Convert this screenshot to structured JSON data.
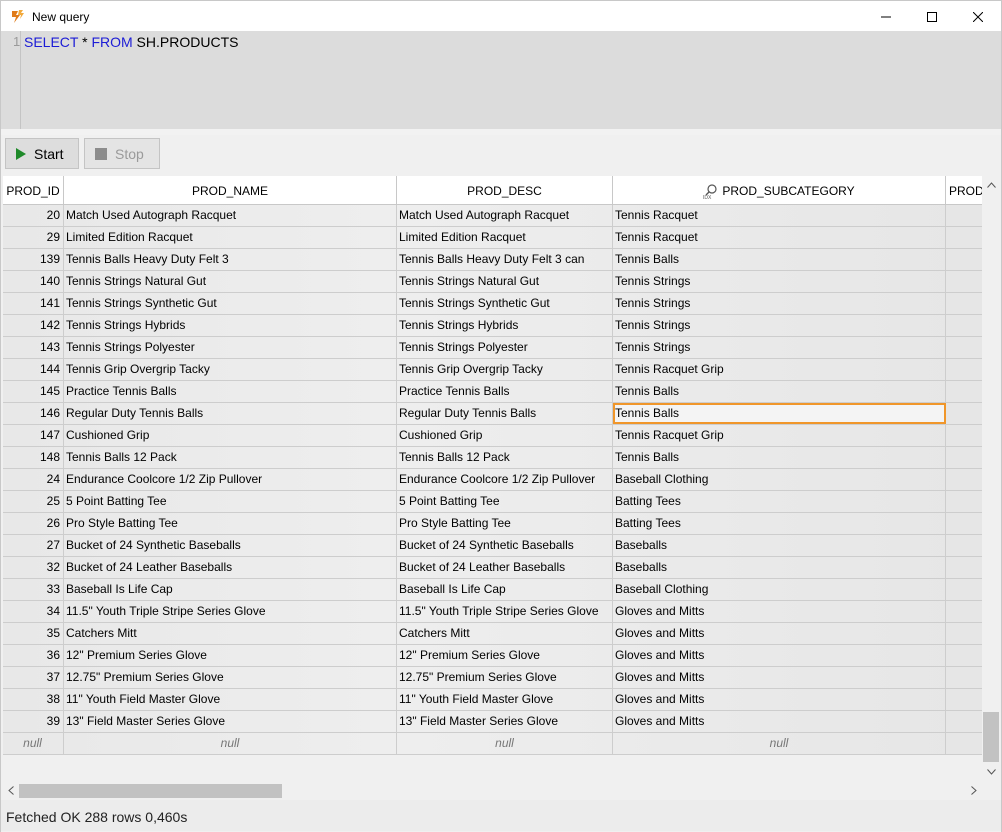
{
  "window": {
    "title": "New query",
    "minimize_icon": "minimize-icon",
    "maximize_icon": "maximize-icon",
    "close_icon": "close-icon"
  },
  "editor": {
    "line_number": "1",
    "keyword_select": "SELECT",
    "star": " * ",
    "keyword_from": "FROM",
    "table": " SH.PRODUCTS"
  },
  "toolbar": {
    "start_label": "Start",
    "stop_label": "Stop"
  },
  "grid": {
    "columns": [
      "PROD_ID",
      "PROD_NAME",
      "PROD_DESC",
      "PROD_SUBCATEGORY",
      "PROD"
    ],
    "index_icon": "index-search-icon",
    "rows": [
      [
        "20",
        "Match Used Autograph Racquet",
        "Match Used Autograph Racquet",
        "Tennis Racquet"
      ],
      [
        "29",
        "Limited Edition Racquet",
        "Limited Edition Racquet",
        "Tennis Racquet"
      ],
      [
        "139",
        "Tennis Balls Heavy Duty Felt 3",
        "Tennis Balls Heavy Duty Felt 3 can",
        "Tennis Balls"
      ],
      [
        "140",
        "Tennis Strings Natural Gut",
        "Tennis Strings Natural Gut",
        "Tennis Strings"
      ],
      [
        "141",
        "Tennis Strings Synthetic Gut",
        "Tennis Strings Synthetic Gut",
        "Tennis Strings"
      ],
      [
        "142",
        "Tennis Strings Hybrids",
        "Tennis Strings Hybrids",
        "Tennis Strings"
      ],
      [
        "143",
        "Tennis Strings Polyester",
        "Tennis Strings Polyester",
        "Tennis Strings"
      ],
      [
        "144",
        "Tennis Grip Overgrip Tacky",
        "Tennis Grip Overgrip Tacky",
        "Tennis Racquet Grip"
      ],
      [
        "145",
        "Practice Tennis Balls",
        "Practice Tennis Balls",
        "Tennis Balls"
      ],
      [
        "146",
        "Regular Duty Tennis Balls",
        "Regular Duty Tennis Balls",
        "Tennis Balls"
      ],
      [
        "147",
        "Cushioned Grip",
        "Cushioned Grip",
        "Tennis Racquet Grip"
      ],
      [
        "148",
        "Tennis Balls 12 Pack",
        "Tennis Balls 12 Pack",
        "Tennis Balls"
      ],
      [
        "24",
        "Endurance Coolcore 1/2 Zip Pullover",
        "Endurance Coolcore 1/2 Zip Pullover",
        "Baseball Clothing"
      ],
      [
        "25",
        "5 Point Batting Tee",
        "5 Point Batting Tee",
        "Batting Tees"
      ],
      [
        "26",
        "Pro Style Batting Tee",
        "Pro Style Batting Tee",
        "Batting Tees"
      ],
      [
        "27",
        "Bucket of 24 Synthetic Baseballs",
        "Bucket of 24 Synthetic Baseballs",
        "Baseballs"
      ],
      [
        "32",
        "Bucket of 24 Leather Baseballs",
        "Bucket of 24 Leather Baseballs",
        "Baseballs"
      ],
      [
        "33",
        "Baseball Is Life Cap",
        "Baseball Is Life Cap",
        "Baseball Clothing"
      ],
      [
        "34",
        "11.5\" Youth Triple Stripe Series Glove",
        "11.5\" Youth Triple Stripe Series Glove",
        "Gloves and Mitts"
      ],
      [
        "35",
        "Catchers Mitt",
        "Catchers Mitt",
        "Gloves and Mitts"
      ],
      [
        "36",
        "12\" Premium Series Glove",
        "12\" Premium Series Glove",
        "Gloves and Mitts"
      ],
      [
        "37",
        "12.75\" Premium Series Glove",
        "12.75\" Premium Series Glove",
        "Gloves and Mitts"
      ],
      [
        "38",
        "11\" Youth Field Master Glove",
        "11\" Youth Field Master Glove",
        "Gloves and Mitts"
      ],
      [
        "39",
        "13\" Field Master Series Glove",
        "13\" Field Master Series Glove",
        "Gloves and Mitts"
      ]
    ],
    "null_label": "null",
    "selected_row": 9,
    "selected_column": 3
  },
  "status": {
    "text": "Fetched OK 288 rows 0,460s"
  },
  "colors": {
    "keyword": "#1c1cd6",
    "start_icon": "#1f8a2a",
    "selection": "#f0962a"
  }
}
